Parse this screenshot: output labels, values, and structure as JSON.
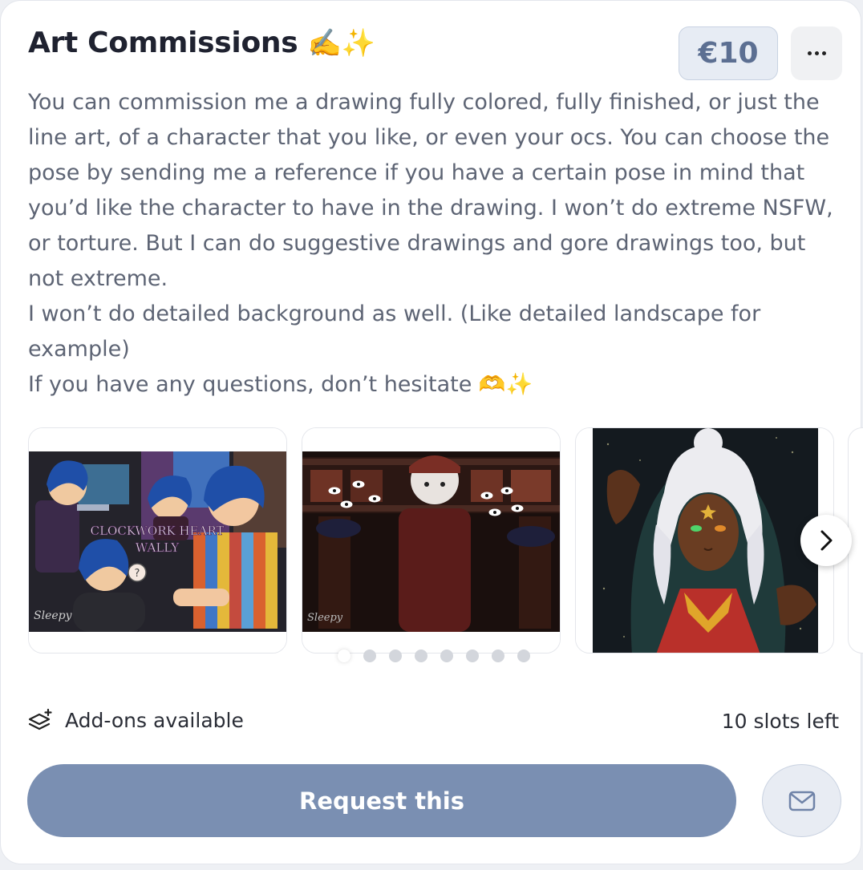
{
  "listing": {
    "title": "Art Commissions",
    "title_emoji": "✍️✨",
    "price": "€10",
    "more_label": "···",
    "description": [
      "You can commission me a drawing fully colored, fully finished, or just the line art, of a character that you like, or even your ocs. You can choose the pose by sending me a reference if you have a certain pose in mind that you’d like the character to have in the drawing. I won’t do extreme NSFW, or torture. But I can do suggestive drawings and gore drawings too, but not extreme.",
      "I won’t do detailed background as well. (Like detailed landscape for example)",
      "If you have any questions, don’t hesitate 🫶✨"
    ]
  },
  "gallery": {
    "tiles": [
      {
        "caption_line1": "CLOCKWORK HEART",
        "caption_line2": "WALLY",
        "signature": "Sleepy"
      },
      {
        "signature": "Sleepy"
      },
      {
        "signature": ""
      }
    ],
    "dots_count": 8,
    "active_dot": 0,
    "next_icon": "chevron-right-icon"
  },
  "footer": {
    "addons_label": "Add-ons available",
    "addons_icon": "layers-plus-icon",
    "slots_label": "10 slots left",
    "request_label": "Request this",
    "message_icon": "mail-icon"
  },
  "colors": {
    "accent": "#7a8fb2",
    "price_text": "#5c6f92",
    "price_bg": "#e7ecf4"
  }
}
